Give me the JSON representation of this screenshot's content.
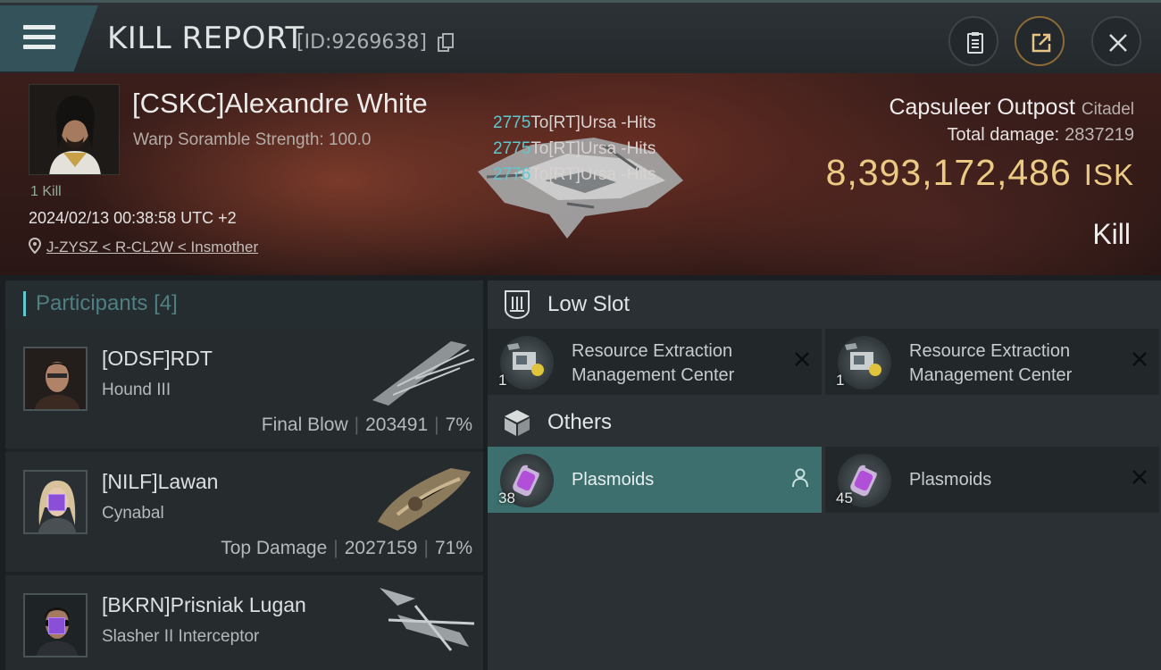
{
  "header": {
    "title": "KILL REPORT",
    "report_id": "[ID:9269638]",
    "icons": [
      "menu-icon",
      "copy-icon",
      "clipboard-icon",
      "share-icon",
      "close-icon"
    ]
  },
  "victim": {
    "name": "[CSKC]Alexandre White",
    "warp_scramble": "Warp Soramble Strength: 100.0",
    "kill_count": "1 Kill",
    "timestamp": "2024/02/13 00:38:58 UTC +2",
    "location": "J-ZYSZ < R-CL2W < Insmother"
  },
  "hits": [
    {
      "count": "2775",
      "text": "To[RT]Ursa -Hits"
    },
    {
      "count": "2775",
      "text": "To[RT]Ursa -Hits"
    },
    {
      "count": "2776",
      "text": "To[RT]Ursa -Hits"
    }
  ],
  "target": {
    "name": "Capsuleer Outpost",
    "type": "Citadel",
    "total_damage_label": "Total damage:",
    "total_damage": "2837219",
    "isk_value": "8,393,172,486",
    "isk_unit": "ISK",
    "result": "Kill"
  },
  "participants": {
    "label": "Participants",
    "count": "[4]",
    "rows": [
      {
        "name": "[ODSF]RDT",
        "ship": "Hound III",
        "tag": "Final Blow",
        "damage": "203491",
        "percent": "7%",
        "badge": false
      },
      {
        "name": "[NILF]Lawan",
        "ship": "Cynabal",
        "tag": "Top Damage",
        "damage": "2027159",
        "percent": "71%",
        "badge": true
      },
      {
        "name": "[BKRN]Prisniak Lugan",
        "ship": "Slasher II Interceptor",
        "tag": "",
        "damage": "",
        "percent": "",
        "badge": true
      }
    ]
  },
  "fitting": {
    "low_slot": {
      "label": "Low Slot",
      "items": [
        {
          "name": "Resource Extraction Management Center",
          "qty": "1"
        },
        {
          "name": "Resource Extraction Management Center",
          "qty": "1"
        }
      ]
    },
    "others": {
      "label": "Others",
      "items": [
        {
          "name": "Plasmoids",
          "qty": "38",
          "state": "dropped"
        },
        {
          "name": "Plasmoids",
          "qty": "45",
          "state": "destroyed"
        }
      ]
    }
  },
  "colors": {
    "accent": "#5fc7cf",
    "isk_gold": "#ecca84",
    "active_item": "#3c6f6d",
    "badge_purple": "#8a4fd6"
  }
}
